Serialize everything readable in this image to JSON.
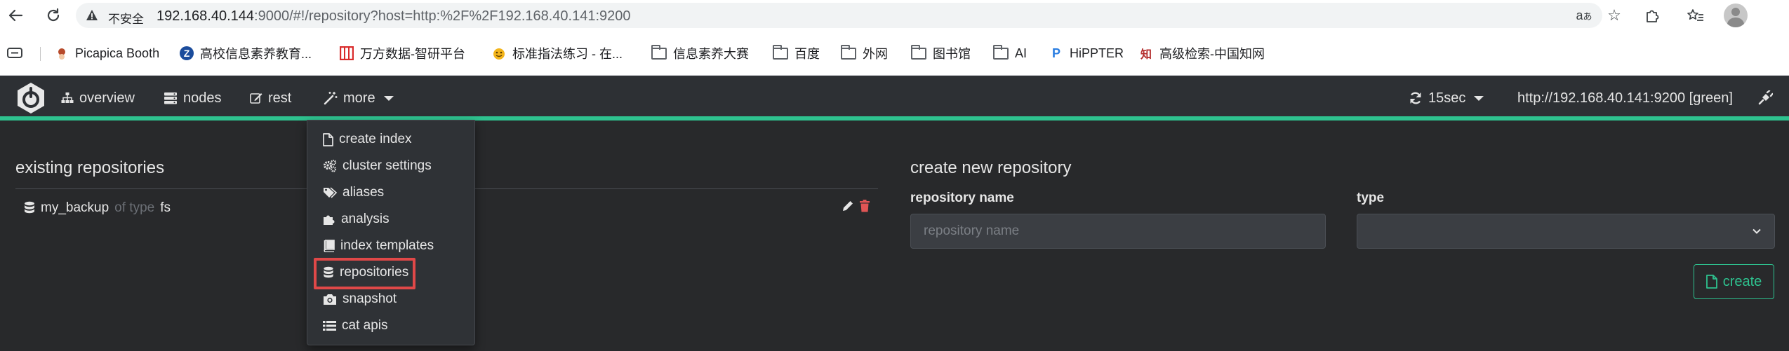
{
  "browser": {
    "security_label": "不安全",
    "url_host": "192.168.40.144",
    "url_path": ":9000/#!/repository?host=http:%2F%2F192.168.40.141:9200",
    "bookmarks": [
      {
        "label": "Picapica Booth",
        "icon": "picapica-icon"
      },
      {
        "label": "高校信息素养教育...",
        "icon": "z-logo-icon"
      },
      {
        "label": "万方数据-智研平台",
        "icon": "wanfang-icon"
      },
      {
        "label": "标准指法练习 - 在...",
        "icon": "typing-icon"
      },
      {
        "label": "信息素养大赛",
        "icon": "folder-icon"
      },
      {
        "label": "百度",
        "icon": "folder-icon"
      },
      {
        "label": "外网",
        "icon": "folder-icon"
      },
      {
        "label": "图书馆",
        "icon": "folder-icon"
      },
      {
        "label": "AI",
        "icon": "folder-icon"
      },
      {
        "label": "HiPPTER",
        "icon": "hippter-icon"
      },
      {
        "label": "高级检索-中国知网",
        "icon": "cnki-icon"
      }
    ]
  },
  "header": {
    "nav": {
      "overview": "overview",
      "nodes": "nodes",
      "rest": "rest",
      "more": "more"
    },
    "refresh_interval": "15sec",
    "cluster": "http://192.168.40.141:9200 [green]"
  },
  "menu": {
    "items": [
      "create index",
      "cluster settings",
      "aliases",
      "analysis",
      "index templates",
      "repositories",
      "snapshot",
      "cat apis"
    ],
    "highlighted": "repositories"
  },
  "existing": {
    "title": "existing repositories",
    "repos": [
      {
        "name": "my_backup",
        "of_type": "of type",
        "type": "fs"
      }
    ]
  },
  "create": {
    "title": "create new repository",
    "name_label": "repository name",
    "name_placeholder": "repository name",
    "name_value": "",
    "type_label": "type",
    "type_value": "",
    "button_label": "create"
  },
  "colors": {
    "accent": "#2ec28f",
    "highlight_border": "#e04848",
    "delete": "#e05555",
    "background": "#28292b",
    "header": "#2d3034"
  }
}
